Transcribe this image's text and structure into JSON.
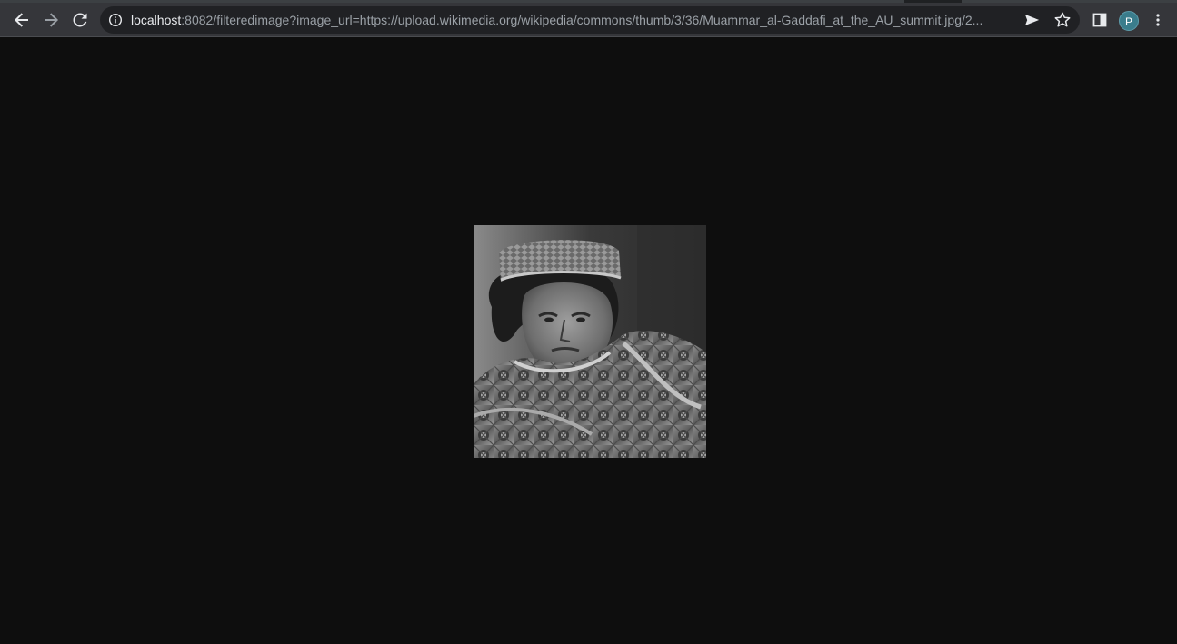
{
  "browser": {
    "nav": {
      "back_icon": "arrow-left-icon",
      "forward_icon": "arrow-right-icon",
      "reload_icon": "reload-icon"
    },
    "omnibox": {
      "info_icon": "info-icon",
      "host": "localhost",
      "url_rest": ":8082/filteredimage?image_url=https://upload.wikimedia.org/wikipedia/commons/thumb/3/36/Muammar_al-Gaddafi_at_the_AU_summit.jpg/2...",
      "send_icon": "send-icon",
      "bookmark_icon": "star-icon"
    },
    "side_panel_icon": "side-panel-icon",
    "profile_initial": "P",
    "menu_icon": "kebab-menu-icon"
  },
  "page": {
    "image_description": "grayscale portrait photo",
    "background_color": "#0e0e0e"
  },
  "colors": {
    "toolbar": "#35363a",
    "omnibox": "#202124",
    "icon": "#e8eaed",
    "icon_disabled": "#9aa0a6",
    "avatar": "#3a7d8c"
  }
}
